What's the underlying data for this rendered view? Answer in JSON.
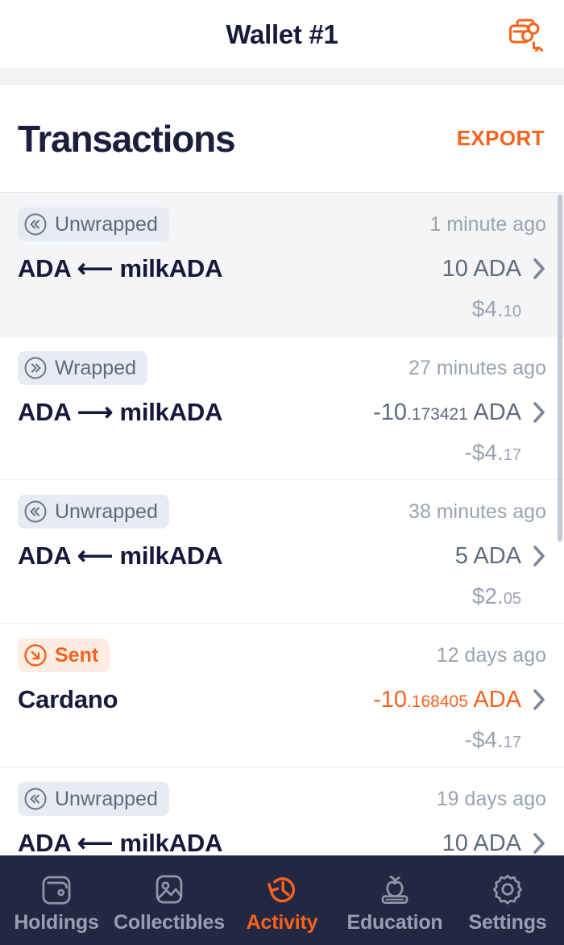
{
  "header": {
    "title": "Wallet #1",
    "action_icon": "switch-wallet-icon"
  },
  "section": {
    "title": "Transactions",
    "export_label": "EXPORT"
  },
  "colors": {
    "accent_orange": "#f5631e",
    "dark_navy": "#16193a",
    "nav_bar": "#242742",
    "muted_text": "#9aa3b0",
    "badge_bg": "#e7ebf2",
    "badge_sent_bg": "#fdece2",
    "row_alt_bg": "#f4f5f6"
  },
  "transactions": [
    {
      "badge": "Unwrapped",
      "badge_icon": "circle-double-chevron-left-icon",
      "badge_kind": "unwrapped",
      "time": "1 minute ago",
      "title": "ADA ⟵ milkADA",
      "amount_int": "10",
      "amount_frac": "",
      "amount_unit": " ADA",
      "amount_color": "muted",
      "fiat_int": "$4.",
      "fiat_frac": "10",
      "highlighted": true
    },
    {
      "badge": "Wrapped",
      "badge_icon": "circle-double-chevron-right-icon",
      "badge_kind": "wrapped",
      "time": "27 minutes ago",
      "title": "ADA ⟶ milkADA",
      "amount_int": "-10",
      "amount_frac": ".173421",
      "amount_unit": " ADA",
      "amount_color": "muted",
      "fiat_int": "-$4.",
      "fiat_frac": "17",
      "highlighted": false
    },
    {
      "badge": "Unwrapped",
      "badge_icon": "circle-double-chevron-left-icon",
      "badge_kind": "unwrapped",
      "time": "38 minutes ago",
      "title": "ADA ⟵ milkADA",
      "amount_int": "5",
      "amount_frac": "",
      "amount_unit": " ADA",
      "amount_color": "muted",
      "fiat_int": "$2.",
      "fiat_frac": "05",
      "highlighted": false
    },
    {
      "badge": "Sent",
      "badge_icon": "circle-arrow-down-right-icon",
      "badge_kind": "sent",
      "time": "12 days ago",
      "title": "Cardano",
      "amount_int": "-10",
      "amount_frac": ".168405",
      "amount_unit": " ADA",
      "amount_color": "orange",
      "fiat_int": "-$4.",
      "fiat_frac": "17",
      "highlighted": false
    },
    {
      "badge": "Unwrapped",
      "badge_icon": "circle-double-chevron-left-icon",
      "badge_kind": "unwrapped",
      "time": "19 days ago",
      "title": "ADA ⟵ milkADA",
      "amount_int": "10",
      "amount_frac": "",
      "amount_unit": " ADA",
      "amount_color": "muted",
      "fiat_int": "",
      "fiat_frac": "",
      "highlighted": false
    }
  ],
  "bottom_nav": {
    "active": "Activity",
    "items": [
      {
        "label": "Holdings",
        "icon": "wallet-icon"
      },
      {
        "label": "Collectibles",
        "icon": "image-icon"
      },
      {
        "label": "Activity",
        "icon": "clock-history-icon"
      },
      {
        "label": "Education",
        "icon": "apple-book-icon"
      },
      {
        "label": "Settings",
        "icon": "gear-icon"
      }
    ]
  }
}
